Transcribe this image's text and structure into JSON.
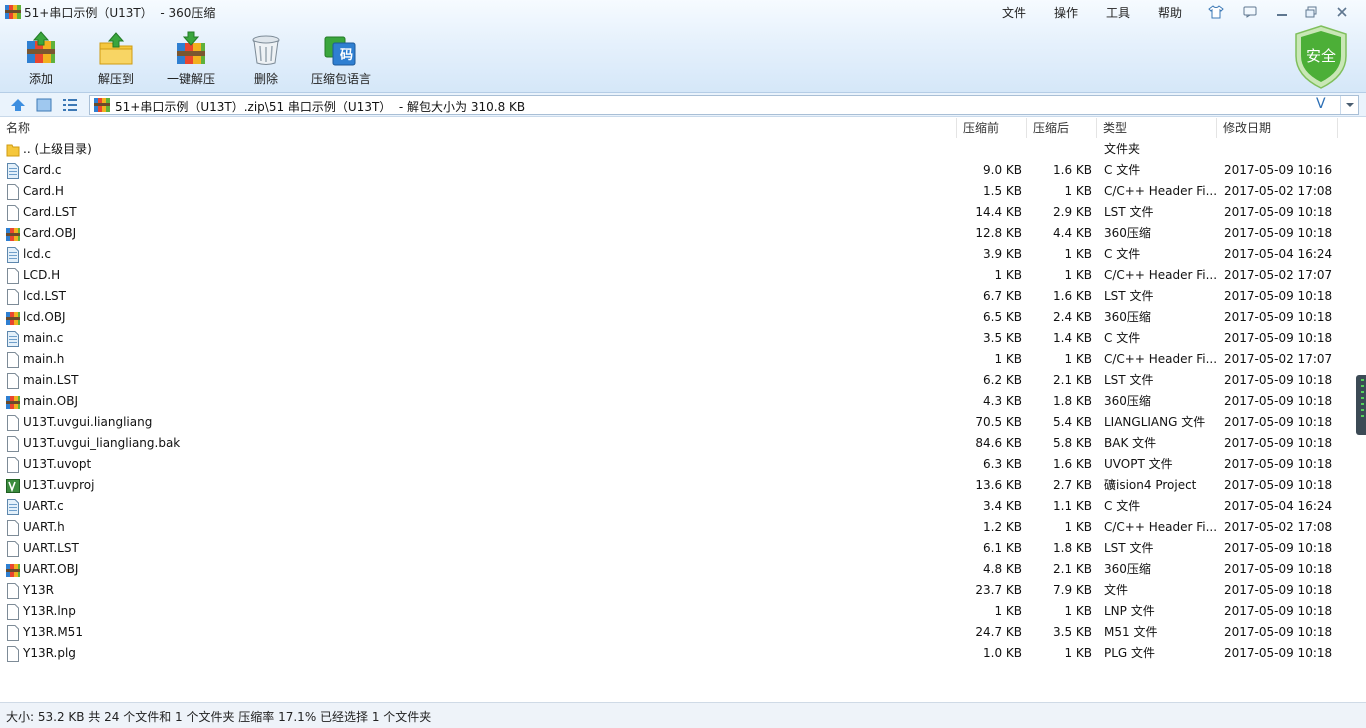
{
  "window": {
    "title": "51+串口示例（U13T）  - 360压缩"
  },
  "menu": [
    "文件",
    "操作",
    "工具",
    "帮助"
  ],
  "toolbar": {
    "add": "添加",
    "extract_to": "解压到",
    "one_click": "一键解压",
    "delete": "删除",
    "encoding": "压缩包语言",
    "encoding_glyph": "码"
  },
  "security_badge": "安全",
  "address": {
    "path": "51+串口示例（U13T）.zip\\51 串口示例（U13T）  - 解包大小为 310.8 KB",
    "v_glyph": "V"
  },
  "columns": {
    "name": "名称",
    "before": "压缩前",
    "after": "压缩后",
    "type": "类型",
    "date": "修改日期"
  },
  "files": [
    {
      "name": ".. (上级目录)",
      "before": "",
      "after": "",
      "type": "文件夹",
      "date": "",
      "icon": "folder-icon"
    },
    {
      "name": "Card.c",
      "before": "9.0 KB",
      "after": "1.6 KB",
      "type": "C 文件",
      "date": "2017-05-09 10:16",
      "icon": "c-file-icon"
    },
    {
      "name": "Card.H",
      "before": "1.5 KB",
      "after": "1 KB",
      "type": "C/C++ Header Fi...",
      "date": "2017-05-02 17:08",
      "icon": "file-icon"
    },
    {
      "name": "Card.LST",
      "before": "14.4 KB",
      "after": "2.9 KB",
      "type": "LST 文件",
      "date": "2017-05-09 10:18",
      "icon": "file-icon"
    },
    {
      "name": "Card.OBJ",
      "before": "12.8 KB",
      "after": "4.4 KB",
      "type": "360压缩",
      "date": "2017-05-09 10:18",
      "icon": "archive-icon"
    },
    {
      "name": "lcd.c",
      "before": "3.9 KB",
      "after": "1 KB",
      "type": "C 文件",
      "date": "2017-05-04 16:24",
      "icon": "c-file-icon"
    },
    {
      "name": "LCD.H",
      "before": "1 KB",
      "after": "1 KB",
      "type": "C/C++ Header Fi...",
      "date": "2017-05-02 17:07",
      "icon": "file-icon"
    },
    {
      "name": "lcd.LST",
      "before": "6.7 KB",
      "after": "1.6 KB",
      "type": "LST 文件",
      "date": "2017-05-09 10:18",
      "icon": "file-icon"
    },
    {
      "name": "lcd.OBJ",
      "before": "6.5 KB",
      "after": "2.4 KB",
      "type": "360压缩",
      "date": "2017-05-09 10:18",
      "icon": "archive-icon"
    },
    {
      "name": "main.c",
      "before": "3.5 KB",
      "after": "1.4 KB",
      "type": "C 文件",
      "date": "2017-05-09 10:18",
      "icon": "c-file-icon"
    },
    {
      "name": "main.h",
      "before": "1 KB",
      "after": "1 KB",
      "type": "C/C++ Header Fi...",
      "date": "2017-05-02 17:07",
      "icon": "file-icon"
    },
    {
      "name": "main.LST",
      "before": "6.2 KB",
      "after": "2.1 KB",
      "type": "LST 文件",
      "date": "2017-05-09 10:18",
      "icon": "file-icon"
    },
    {
      "name": "main.OBJ",
      "before": "4.3 KB",
      "after": "1.8 KB",
      "type": "360压缩",
      "date": "2017-05-09 10:18",
      "icon": "archive-icon"
    },
    {
      "name": "U13T.uvgui.liangliang",
      "before": "70.5 KB",
      "after": "5.4 KB",
      "type": "LIANGLIANG 文件",
      "date": "2017-05-09 10:18",
      "icon": "file-icon"
    },
    {
      "name": "U13T.uvgui_liangliang.bak",
      "before": "84.6 KB",
      "after": "5.8 KB",
      "type": "BAK 文件",
      "date": "2017-05-09 10:18",
      "icon": "file-icon"
    },
    {
      "name": "U13T.uvopt",
      "before": "6.3 KB",
      "after": "1.6 KB",
      "type": "UVOPT 文件",
      "date": "2017-05-09 10:18",
      "icon": "file-icon"
    },
    {
      "name": "U13T.uvproj",
      "before": "13.6 KB",
      "after": "2.7 KB",
      "type": "礦ision4 Project",
      "date": "2017-05-09 10:18",
      "icon": "uvproj-icon"
    },
    {
      "name": "UART.c",
      "before": "3.4 KB",
      "after": "1.1 KB",
      "type": "C 文件",
      "date": "2017-05-04 16:24",
      "icon": "c-file-icon"
    },
    {
      "name": "UART.h",
      "before": "1.2 KB",
      "after": "1 KB",
      "type": "C/C++ Header Fi...",
      "date": "2017-05-02 17:08",
      "icon": "file-icon"
    },
    {
      "name": "UART.LST",
      "before": "6.1 KB",
      "after": "1.8 KB",
      "type": "LST 文件",
      "date": "2017-05-09 10:18",
      "icon": "file-icon"
    },
    {
      "name": "UART.OBJ",
      "before": "4.8 KB",
      "after": "2.1 KB",
      "type": "360压缩",
      "date": "2017-05-09 10:18",
      "icon": "archive-icon"
    },
    {
      "name": "Y13R",
      "before": "23.7 KB",
      "after": "7.9 KB",
      "type": "文件",
      "date": "2017-05-09 10:18",
      "icon": "file-icon"
    },
    {
      "name": "Y13R.lnp",
      "before": "1 KB",
      "after": "1 KB",
      "type": "LNP 文件",
      "date": "2017-05-09 10:18",
      "icon": "file-icon"
    },
    {
      "name": "Y13R.M51",
      "before": "24.7 KB",
      "after": "3.5 KB",
      "type": "M51 文件",
      "date": "2017-05-09 10:18",
      "icon": "file-icon"
    },
    {
      "name": "Y13R.plg",
      "before": "1.0 KB",
      "after": "1 KB",
      "type": "PLG 文件",
      "date": "2017-05-09 10:18",
      "icon": "file-icon"
    }
  ],
  "status": "大小: 53.2 KB 共 24 个文件和 1 个文件夹 压缩率 17.1% 已经选择 1 个文件夹",
  "colors": {
    "accent": "#2d6fb5",
    "shield": "#4caf37"
  }
}
